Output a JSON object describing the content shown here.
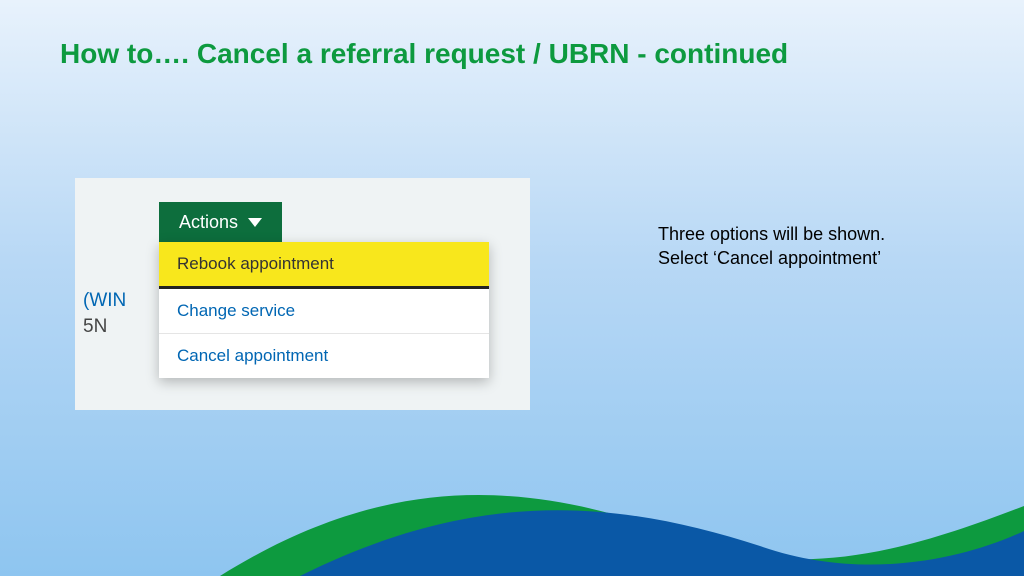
{
  "title": "How to…. Cancel a referral request / UBRN - continued",
  "actions_label": "Actions",
  "dropdown": {
    "items": [
      {
        "label": "Rebook appointment",
        "highlighted": true
      },
      {
        "label": "Change service",
        "highlighted": false
      },
      {
        "label": "Cancel appointment",
        "highlighted": false
      }
    ]
  },
  "bg_text": {
    "win": "(WIN",
    "fn": "5N"
  },
  "instruction": {
    "line1": "Three options will be shown.",
    "line2": "Select ‘Cancel appointment’"
  }
}
